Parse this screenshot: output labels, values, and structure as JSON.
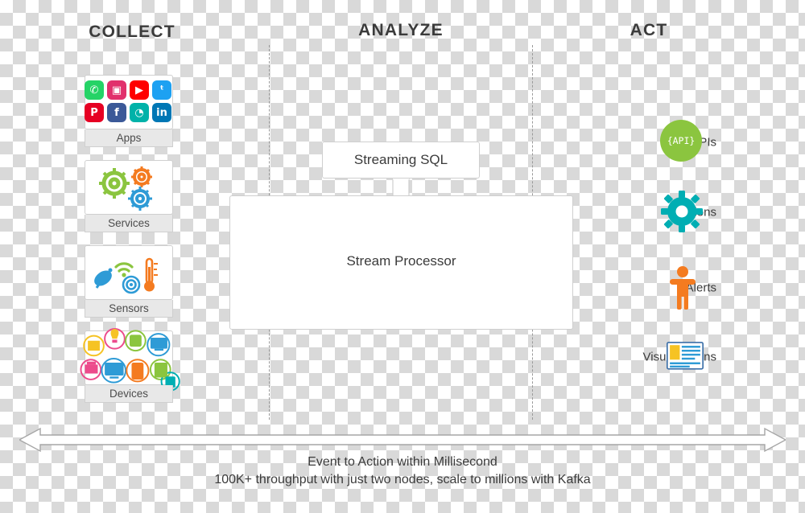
{
  "columns": {
    "collect": "COLLECT",
    "analyze": "ANALYZE",
    "act": "ACT"
  },
  "sources": [
    {
      "key": "apps",
      "label": "Apps"
    },
    {
      "key": "services",
      "label": "Services"
    },
    {
      "key": "sensors",
      "label": "Sensors"
    },
    {
      "key": "devices",
      "label": "Devices"
    }
  ],
  "apps_icons": [
    {
      "name": "whatsapp-icon",
      "glyph": "✆",
      "color": "#25D366"
    },
    {
      "name": "instagram-icon",
      "glyph": "▣",
      "color": "#E1306C"
    },
    {
      "name": "youtube-icon",
      "glyph": "▶",
      "color": "#FF0000"
    },
    {
      "name": "twitter-icon",
      "glyph": "ᵗ",
      "color": "#1DA1F2"
    },
    {
      "name": "pinterest-icon",
      "glyph": "P",
      "color": "#E60023"
    },
    {
      "name": "facebook-icon",
      "glyph": "f",
      "color": "#3B5998"
    },
    {
      "name": "chat-icon",
      "glyph": "◔",
      "color": "#00B2A9"
    },
    {
      "name": "linkedin-icon",
      "glyph": "in",
      "color": "#0077B5"
    }
  ],
  "analyze": {
    "sql_box": "Streaming SQL",
    "processor_box": "Stream Processor"
  },
  "act_items": [
    {
      "key": "apis",
      "label": "APIs",
      "icon": "api-bubble-icon",
      "badge": "{API}"
    },
    {
      "key": "actions",
      "label": "Actions",
      "icon": "gear-icon",
      "badge": ""
    },
    {
      "key": "alerts",
      "label": "Alerts",
      "icon": "person-alert-icon",
      "badge": ""
    },
    {
      "key": "visualizations",
      "label": "Visualizations",
      "icon": "dashboard-icon",
      "badge": ""
    }
  ],
  "footer": {
    "line1": "Event to Action within Millisecond",
    "line2": "100K+ throughput with just two nodes, scale to millions with Kafka"
  },
  "colors": {
    "teal": "#00AEB3",
    "orange": "#F47B20",
    "green": "#8BC53F",
    "blue": "#2E9BD6",
    "pink": "#EC4B8C",
    "yellow": "#F6C324",
    "gray_text": "#3B3B3B",
    "card_border": "#CFCFCF",
    "label_bg": "#E8E8E8",
    "arrow_gray": "#A6A6A6"
  }
}
